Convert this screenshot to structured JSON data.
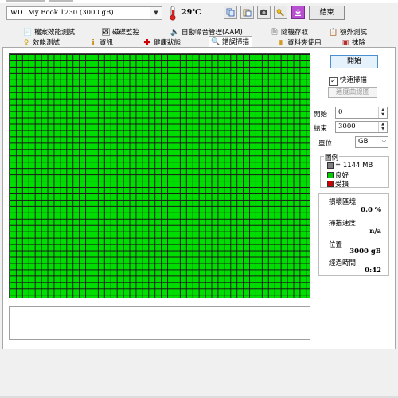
{
  "toolbar": {
    "drive_brand": "WD",
    "drive_name": "My Book 1230 (3000 gB)",
    "temperature": "29℃",
    "exit_label": "結束",
    "icons": [
      "copy-icon",
      "paste-icon",
      "camera-icon",
      "key-icon",
      "download-icon"
    ]
  },
  "tabs": {
    "row1": [
      {
        "label": "檔案效能測試",
        "icon": "file-benchmark-icon"
      },
      {
        "label": "磁碟監控",
        "icon": "disk-monitor-icon"
      },
      {
        "label": "自動噪音管理(AAM)",
        "icon": "speaker-icon"
      },
      {
        "label": "隨機存取",
        "icon": "random-access-icon"
      },
      {
        "label": "額外測試",
        "icon": "extra-tests-icon"
      }
    ],
    "row2": [
      {
        "label": "效能測試",
        "icon": "benchmark-icon"
      },
      {
        "label": "資訊",
        "icon": "info-icon"
      },
      {
        "label": "健康狀態",
        "icon": "health-cross-icon"
      },
      {
        "label": "錯誤掃描",
        "icon": "magnifier-icon",
        "active": true
      },
      {
        "label": "資料夾使用",
        "icon": "folder-usage-icon"
      },
      {
        "label": "抹除",
        "icon": "erase-icon"
      }
    ]
  },
  "scan": {
    "start_label": "開始",
    "quick_scan_label": "快速掃描",
    "quick_scan_checked": true,
    "speed_map_label": "速度曲線圖",
    "start_field_label": "開始",
    "start_value": "0",
    "end_field_label": "結束",
    "end_value": "3000",
    "unit_label": "單位",
    "unit_value": "GB",
    "legend": {
      "title": "圖例",
      "block_size": "= 1144 MB",
      "good": "良好",
      "damaged": "受損",
      "colors": {
        "block": "#808080",
        "good": "#00cc00",
        "damaged": "#cc0000"
      }
    },
    "stats": {
      "damaged_label": "損壞區塊",
      "damaged_value": "0.0 %",
      "speed_label": "掃描速度",
      "speed_value": "n/a",
      "position_label": "位置",
      "position_value": "3000 gB",
      "elapsed_label": "經過時間",
      "elapsed_value": "0:42"
    }
  },
  "colors": {
    "good_block": "#00dd00",
    "grid_line": "#1a1a1a"
  }
}
